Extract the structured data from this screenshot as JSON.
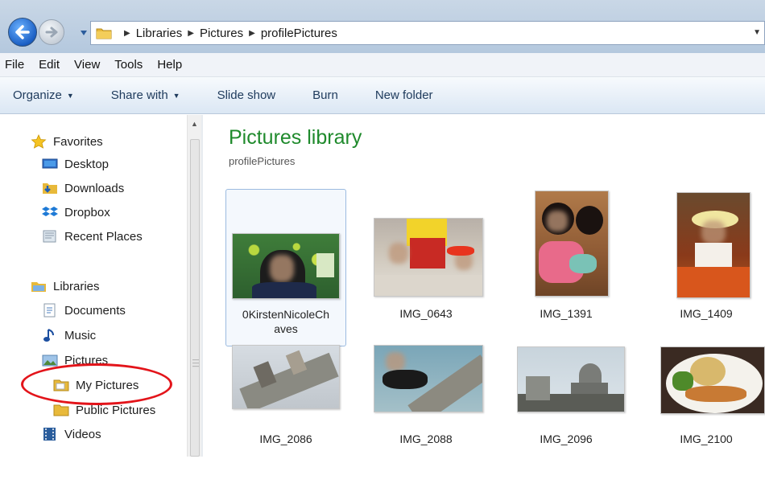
{
  "address": {
    "crumbs": [
      "Libraries",
      "Pictures",
      "profilePictures"
    ]
  },
  "menu": [
    "File",
    "Edit",
    "View",
    "Tools",
    "Help"
  ],
  "toolbar": {
    "organize": "Organize",
    "share": "Share with",
    "slideshow": "Slide show",
    "burn": "Burn",
    "new_folder": "New folder"
  },
  "nav": {
    "favorites": "Favorites",
    "desktop": "Desktop",
    "downloads": "Downloads",
    "dropbox": "Dropbox",
    "recent": "Recent Places",
    "libraries": "Libraries",
    "documents": "Documents",
    "music": "Music",
    "pictures": "Pictures",
    "my_pictures": "My Pictures",
    "public_pictures": "Public Pictures",
    "videos": "Videos"
  },
  "content": {
    "title": "Pictures library",
    "subtitle": "profilePictures",
    "items": [
      {
        "line1": "0KirstenNicoleCh",
        "line2": "aves"
      },
      {
        "line1": "IMG_0643"
      },
      {
        "line1": "IMG_1391"
      },
      {
        "line1": "IMG_1409"
      },
      {
        "line1": "IMG_2086"
      },
      {
        "line1": "IMG_2088"
      },
      {
        "line1": "IMG_2096"
      },
      {
        "line1": "IMG_2100"
      }
    ]
  },
  "colors": {
    "library_title": "#1f8a2c",
    "highlight_oval": "#e3141a",
    "toolbar_text": "#1e3a5c"
  },
  "icons": [
    "back-arrow-icon",
    "forward-arrow-icon",
    "folder-icon",
    "star-icon",
    "desktop-icon",
    "downloads-icon",
    "dropbox-icon",
    "recent-places-icon",
    "libraries-icon",
    "documents-icon",
    "music-icon",
    "pictures-icon",
    "videos-icon"
  ]
}
